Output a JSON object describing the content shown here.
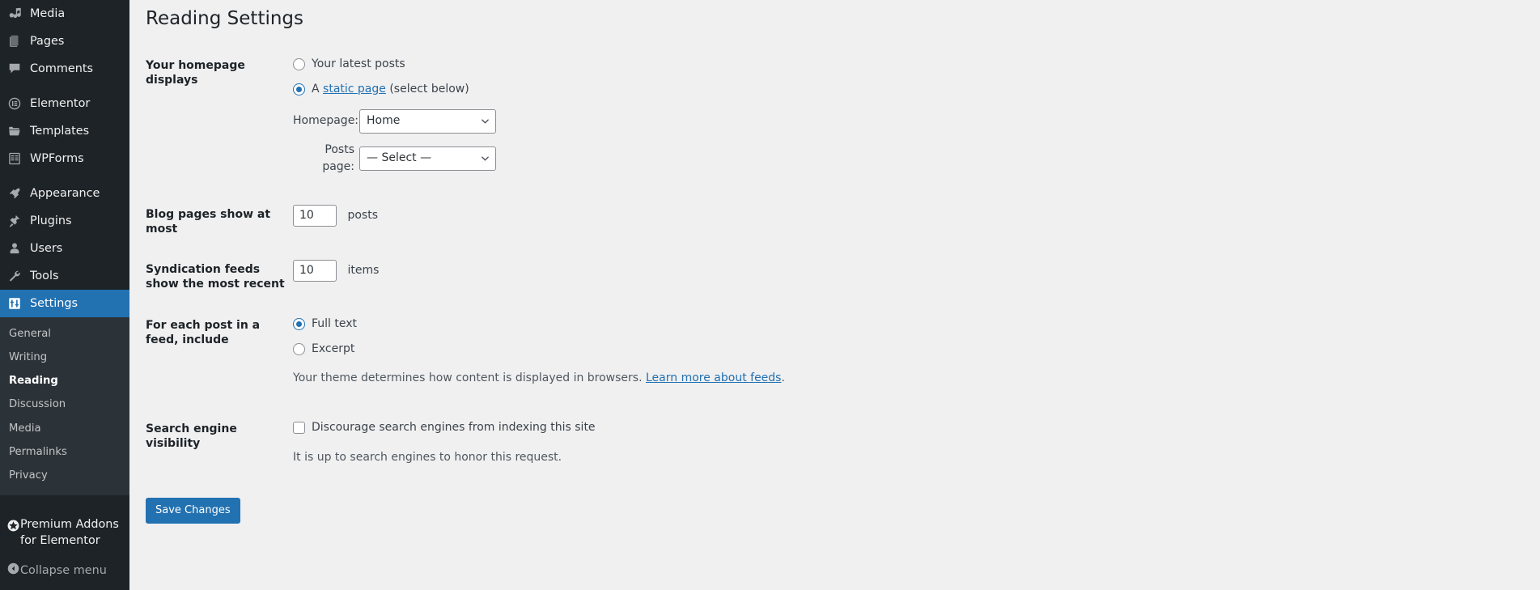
{
  "sidebar": {
    "items": [
      {
        "label": "Media",
        "icon": "media-icon"
      },
      {
        "label": "Pages",
        "icon": "pages-icon"
      },
      {
        "label": "Comments",
        "icon": "comments-icon"
      },
      {
        "label": "Elementor",
        "icon": "elementor-icon"
      },
      {
        "label": "Templates",
        "icon": "templates-icon"
      },
      {
        "label": "WPForms",
        "icon": "wpforms-icon"
      },
      {
        "label": "Appearance",
        "icon": "appearance-icon"
      },
      {
        "label": "Plugins",
        "icon": "plugins-icon"
      },
      {
        "label": "Users",
        "icon": "users-icon"
      },
      {
        "label": "Tools",
        "icon": "tools-icon"
      },
      {
        "label": "Settings",
        "icon": "settings-icon"
      }
    ],
    "submenu": [
      "General",
      "Writing",
      "Reading",
      "Discussion",
      "Media",
      "Permalinks",
      "Privacy"
    ],
    "current_submenu": "Reading",
    "premium_addons": "Premium Addons for Elementor",
    "collapse_menu": "Collapse menu",
    "active_color": "#2271b1",
    "background_color": "#1d2327",
    "submenu_background_color": "#2c3338"
  },
  "page": {
    "title": "Reading Settings"
  },
  "homepage_displays": {
    "label": "Your homepage displays",
    "option_latest_posts": "Your latest posts",
    "option_static_prefix": "A ",
    "option_static_link": "static page",
    "option_static_suffix": " (select below)",
    "selected": "static_page",
    "homepage_label": "Homepage:",
    "homepage_value": "Home",
    "posts_page_label": "Posts page:",
    "posts_page_value": "— Select —"
  },
  "blog_pages": {
    "label": "Blog pages show at most",
    "value": "10",
    "unit": "posts"
  },
  "syndication": {
    "label": "Syndication feeds show the most recent",
    "value": "10",
    "unit": "items"
  },
  "feed_include": {
    "label": "For each post in a feed, include",
    "option_full_text": "Full text",
    "option_excerpt": "Excerpt",
    "selected": "full_text",
    "description_prefix": "Your theme determines how content is displayed in browsers. ",
    "description_link": "Learn more about feeds",
    "description_suffix": "."
  },
  "search_visibility": {
    "label": "Search engine visibility",
    "checkbox_label": "Discourage search engines from indexing this site",
    "checked": false,
    "description": "It is up to search engines to honor this request."
  },
  "submit": {
    "save_label": "Save Changes"
  }
}
